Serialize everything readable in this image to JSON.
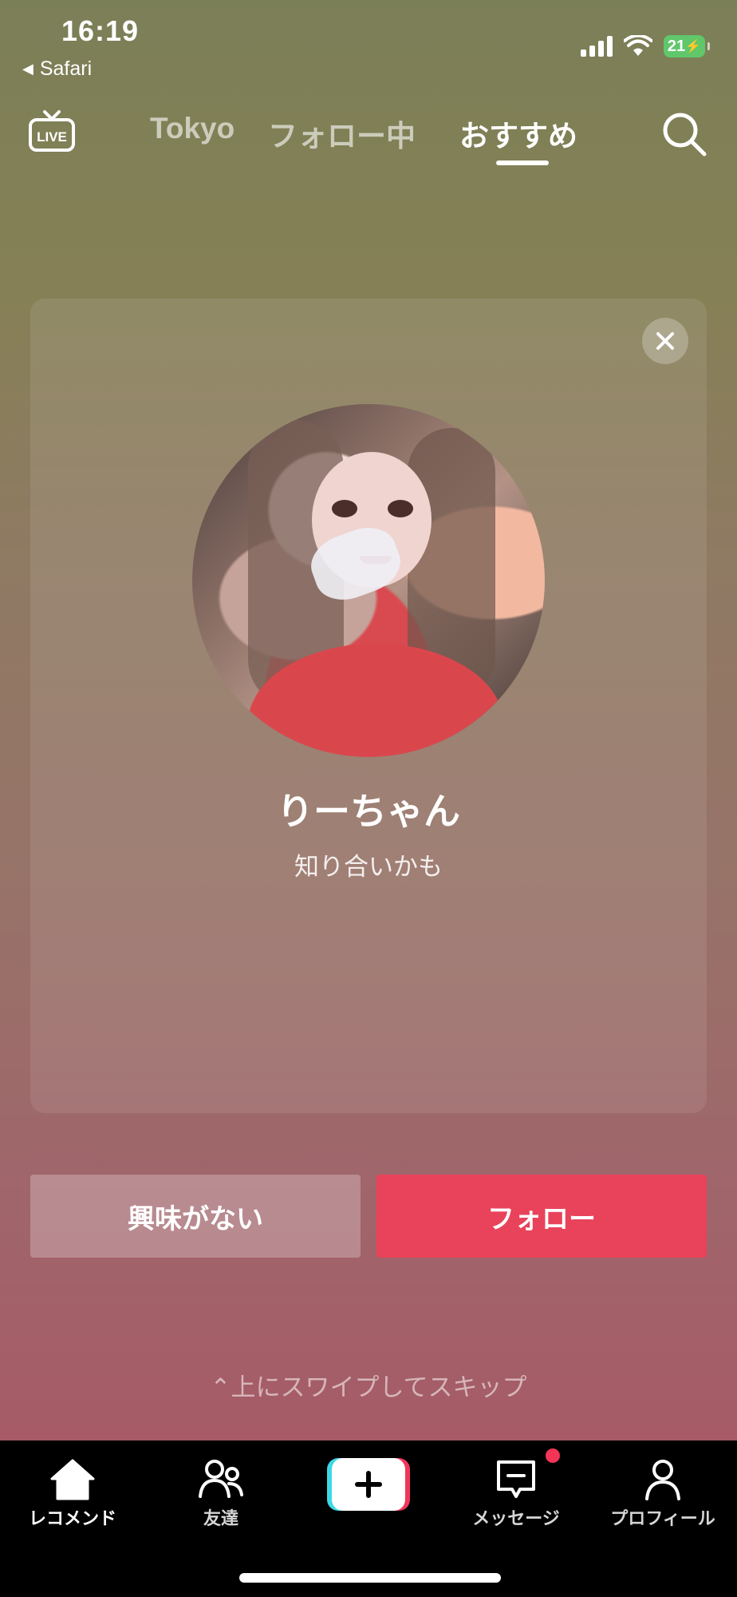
{
  "status_bar": {
    "time": "16:19",
    "back_app": "Safari",
    "battery": "21"
  },
  "top_nav": {
    "tabs": [
      {
        "label": "Tokyo"
      },
      {
        "label": "フォロー中"
      },
      {
        "label": "おすすめ",
        "active": true
      }
    ]
  },
  "card": {
    "name": "りーちゃん",
    "subtitle": "知り合いかも"
  },
  "actions": {
    "not_interested": "興味がない",
    "follow": "フォロー"
  },
  "swipe_hint": "上にスワイプしてスキップ",
  "bottom_nav": {
    "items": [
      {
        "label": "レコメンド",
        "icon": "home-icon",
        "active": true
      },
      {
        "label": "友達",
        "icon": "friends-icon"
      },
      {
        "label": "",
        "icon": "create-plus-icon"
      },
      {
        "label": "メッセージ",
        "icon": "message-icon",
        "badge": true
      },
      {
        "label": "プロフィール",
        "icon": "profile-icon"
      }
    ]
  },
  "colors": {
    "follow": "#e8435a",
    "battery": "#60c76b",
    "badge": "#f23556"
  }
}
